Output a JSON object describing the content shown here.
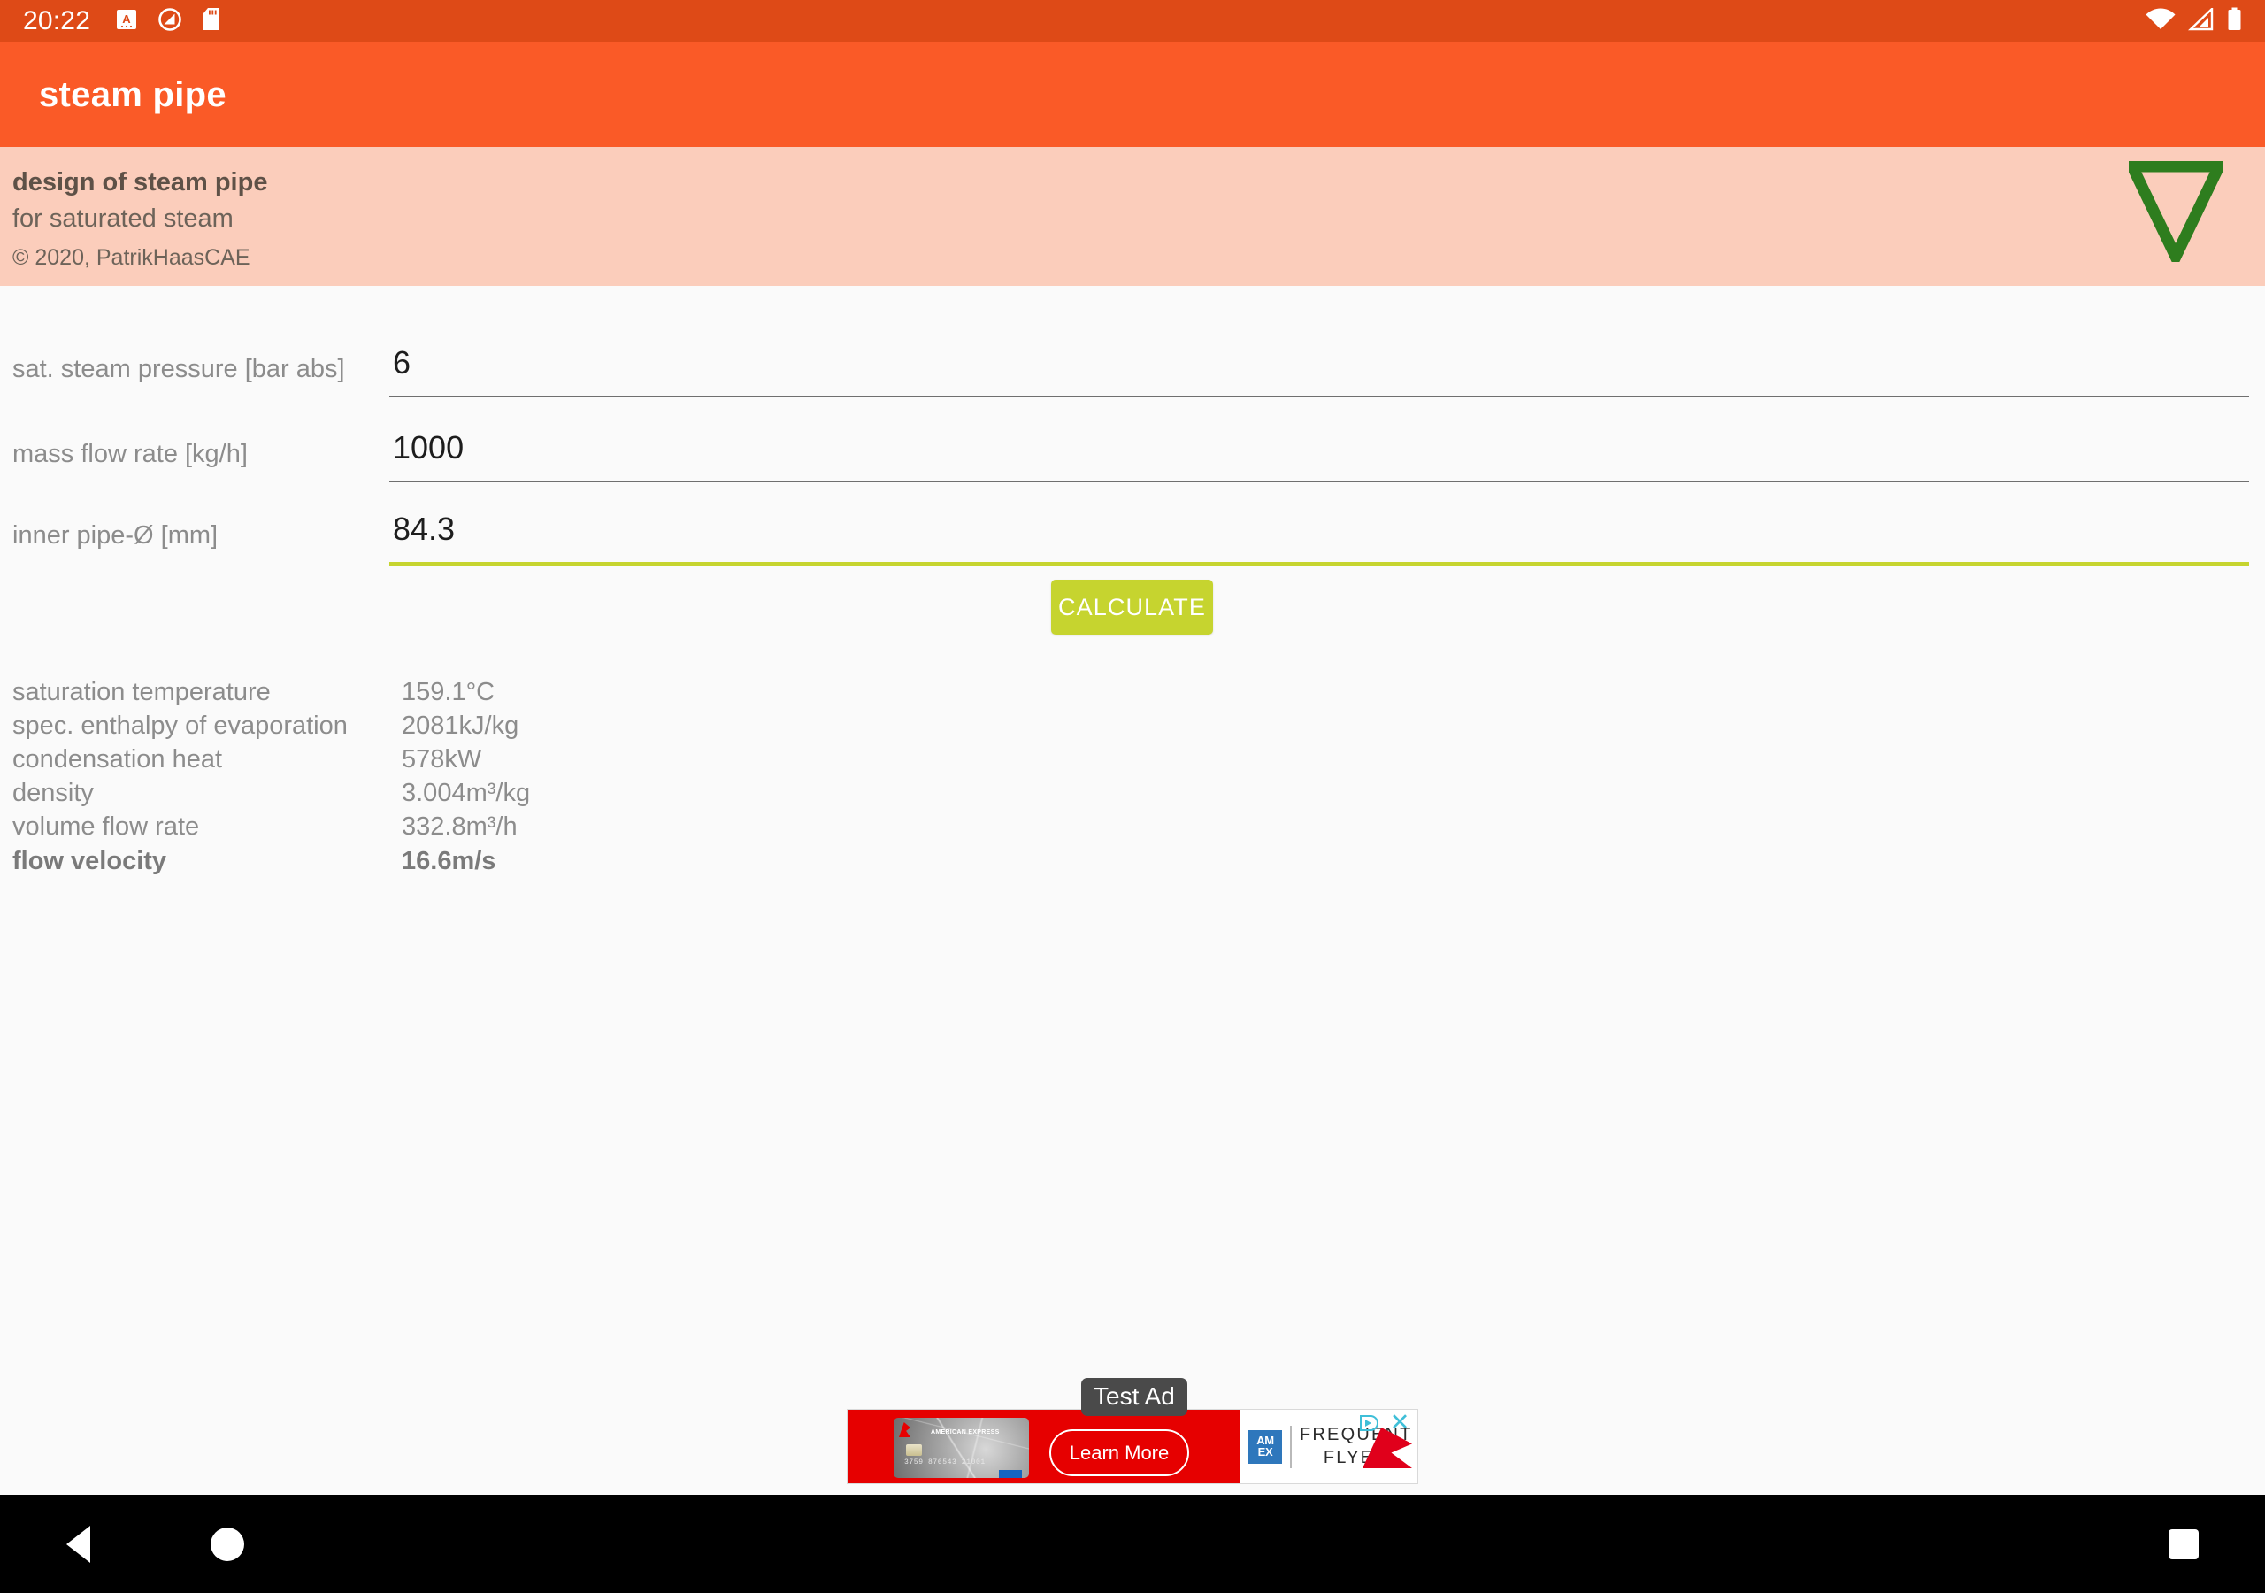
{
  "status_bar": {
    "clock": "20:22",
    "left_icons": [
      "a-badge-icon",
      "do-not-disturb-icon",
      "sd-card-icon"
    ],
    "right_icons": [
      "wifi-icon",
      "cellular-signal-icon",
      "battery-icon"
    ],
    "background_color": "#DE4A17"
  },
  "app_bar": {
    "title": "steam pipe",
    "background_color": "#FA5A27",
    "text_color": "#FFFFFF"
  },
  "banner": {
    "title": "design of steam pipe",
    "subtitle": "for saturated steam",
    "copyright": "© 2020, PatrikHaasCAE",
    "background_color": "#FBCDBB",
    "logo": "nabla-triangle-logo",
    "logo_color": "#2E7D1E"
  },
  "form": {
    "fields": [
      {
        "label": "sat. steam pressure [bar abs]",
        "value": "6",
        "focused": false
      },
      {
        "label": "mass flow rate [kg/h]",
        "value": "1000",
        "focused": false
      },
      {
        "label": "inner pipe-Ø [mm]",
        "value": "84.3",
        "focused": true
      }
    ],
    "focus_underline_color": "#C6D42F",
    "underline_color": "#6F6F6F"
  },
  "actions": {
    "calculate_label": "CALCULATE",
    "calculate_color": "#C6D42F"
  },
  "results": {
    "rows": [
      {
        "label": "saturation temperature",
        "value": "159.1°C",
        "bold": false
      },
      {
        "label": "spec. enthalpy of evaporation",
        "value": "2081kJ/kg",
        "bold": false
      },
      {
        "label": "condensation heat",
        "value": "578kW",
        "bold": false
      },
      {
        "label": "density",
        "value": "3.004m³/kg",
        "bold": false
      },
      {
        "label": "volume flow rate",
        "value": "332.8m³/h",
        "bold": false
      },
      {
        "label": "flow velocity",
        "value": "16.6m/s",
        "bold": true
      }
    ]
  },
  "ad": {
    "test_label": "Test Ad",
    "cta_label": "Learn More",
    "card_brand": "AMERICAN EXPRESS",
    "card_number": "3759 876543 21001",
    "amex_line1": "AM",
    "amex_line2": "EX",
    "frequent_flyer_line1": "FREQUENT",
    "frequent_flyer_line2": "FLYER",
    "close_label": "✕",
    "adchoices_icon": "adchoices-icon",
    "background_color": "#E60000"
  },
  "nav_bar": {
    "items": [
      "back-button",
      "home-button",
      "recents-button"
    ],
    "background_color": "#000000"
  }
}
